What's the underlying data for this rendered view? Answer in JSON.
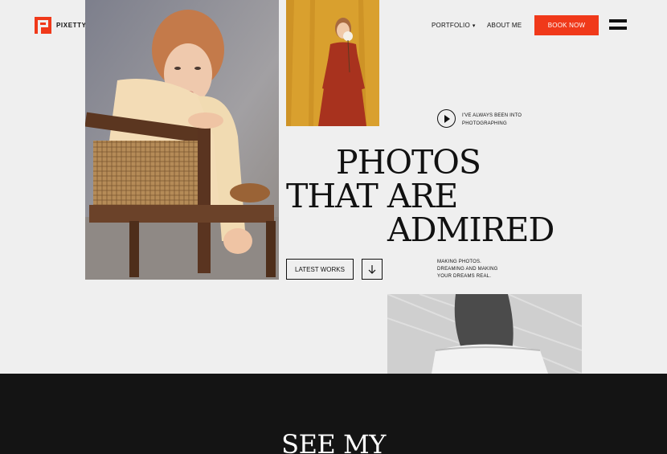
{
  "brand": {
    "name": "PIXETTY",
    "accent": "#f0391a"
  },
  "nav": {
    "portfolio_label": "PORTFOLIO",
    "about_label": "ABOUT ME",
    "book_label": "BOOK NOW"
  },
  "hero": {
    "video_caption": "I'VE ALWAYS BEEN INTO PHOTOGRAPHING",
    "headline_line1": "PHOTOS",
    "headline_line2": "THAT ARE",
    "headline_line3": "ADMIRED",
    "latest_works_label": "LATEST WORKS",
    "tagline": "MAKING PHOTOS. DREAMING AND MAKING YOUR DREAMS REAL."
  },
  "section": {
    "title": "SEE MY"
  },
  "icons": [
    "logo-mark-icon",
    "caret-down-icon",
    "hamburger-icon",
    "play-icon",
    "arrow-down-icon"
  ]
}
